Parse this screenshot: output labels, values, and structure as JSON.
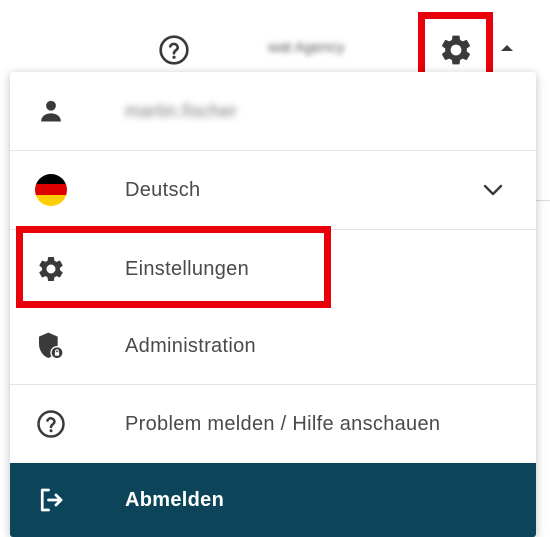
{
  "header": {
    "agency_name": "wat Agency",
    "help_icon": "question-circle-icon",
    "settings_icon": "gear-icon",
    "caret_icon": "caret-up-icon"
  },
  "menu": {
    "user": {
      "icon": "person-icon",
      "label": "martin.fischer"
    },
    "language": {
      "icon": "german-flag-icon",
      "label": "Deutsch",
      "chevron_icon": "chevron-down-icon"
    },
    "settings": {
      "icon": "gear-icon",
      "label": "Einstellungen"
    },
    "administration": {
      "icon": "shield-lock-icon",
      "label": "Administration"
    },
    "problem": {
      "icon": "question-circle-icon",
      "label": "Problem melden / Hilfe anschauen"
    },
    "logout": {
      "icon": "logout-icon",
      "label": "Abmelden"
    }
  },
  "colors": {
    "highlight": "#e8000b",
    "logout_bg": "#0c4459",
    "icon": "#3a3a3a"
  }
}
